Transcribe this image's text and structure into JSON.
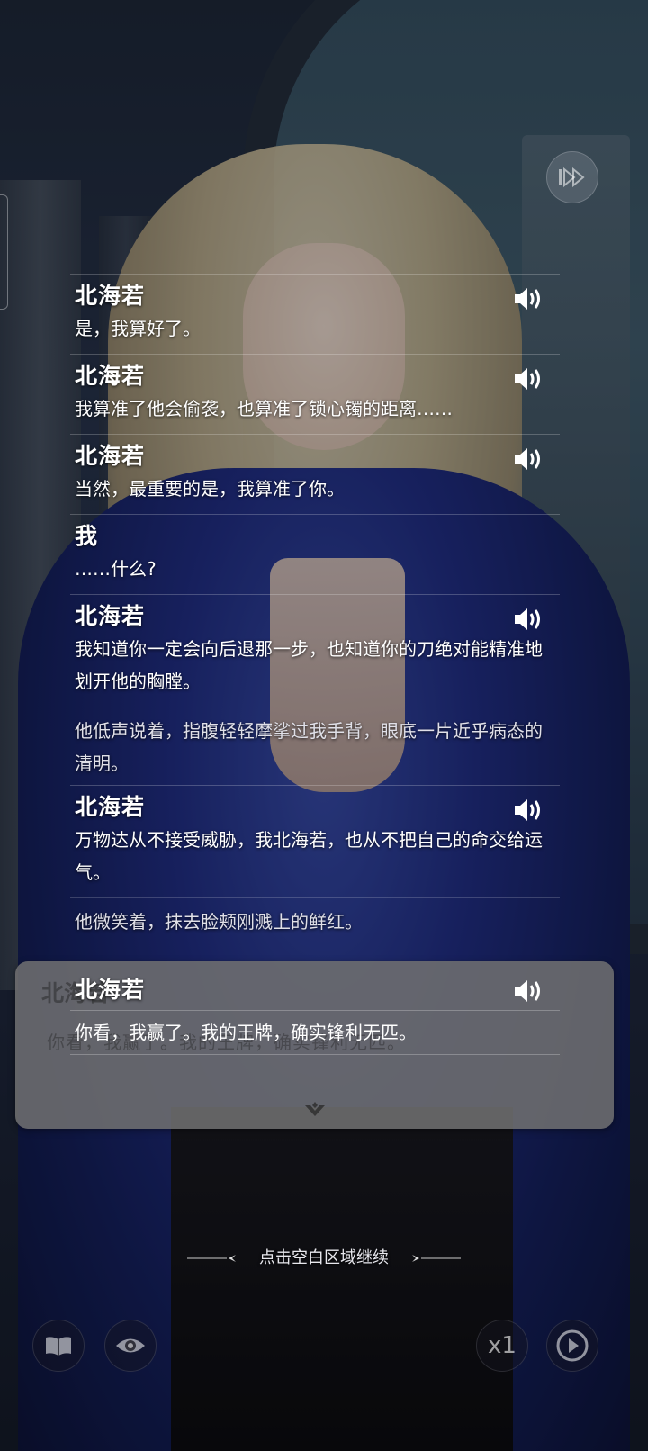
{
  "log": [
    {
      "type": "dialogue",
      "speaker": "北海若",
      "text": "是，我算好了。",
      "voice": true
    },
    {
      "type": "dialogue",
      "speaker": "北海若",
      "text": "我算准了他会偷袭，也算准了锁心镯的距离……",
      "voice": true
    },
    {
      "type": "dialogue",
      "speaker": "北海若",
      "text": "当然，最重要的是，我算准了你。",
      "voice": true
    },
    {
      "type": "dialogue",
      "speaker": "我",
      "text": "……什么?",
      "voice": false
    },
    {
      "type": "dialogue",
      "speaker": "北海若",
      "text": "我知道你一定会向后退那一步，也知道你的刀绝对能精准地划开他的胸膛。",
      "voice": true
    },
    {
      "type": "narration",
      "text": "他低声说着，指腹轻轻摩挲过我手背，眼底一片近乎病态的清明。"
    },
    {
      "type": "dialogue",
      "speaker": "北海若",
      "text": "万物达从不接受威胁，我北海若，也从不把自己的命交给运气。",
      "voice": true
    },
    {
      "type": "narration",
      "text": "他微笑着，抹去脸颊刚溅上的鲜红。"
    }
  ],
  "current": {
    "speaker": "北海若",
    "text": "你看，我赢了。我的王牌，确实锋利无匹。",
    "voice": true,
    "ghost_speaker": "北海若",
    "ghost_text": "你看，我赢了。我的王牌，确实锋利无匹。"
  },
  "hint": "点击空白区域继续",
  "controls": {
    "speed_label": "x1",
    "icons": [
      "book-icon",
      "eye-icon",
      "speed-button",
      "auto-play-icon",
      "skip-icon"
    ]
  }
}
